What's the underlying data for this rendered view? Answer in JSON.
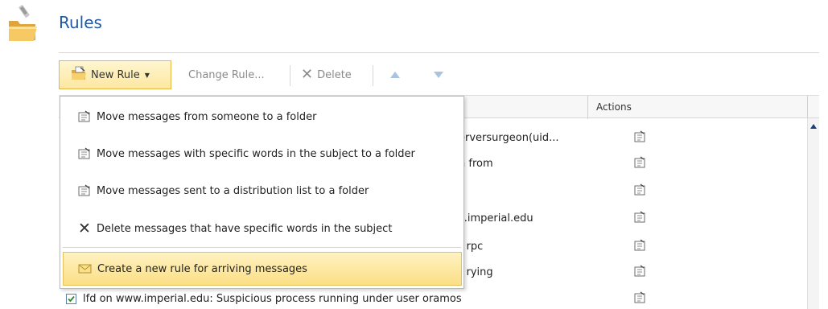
{
  "header": {
    "title": "Rules",
    "icon": "folder-rules-icon"
  },
  "toolbar": {
    "new_rule": "New Rule",
    "change_rule": "Change Rule...",
    "delete": "Delete",
    "move_up": "move-up-icon",
    "move_down": "move-down-icon"
  },
  "grid": {
    "columns": [
      "Actions"
    ],
    "rows": [
      {
        "name_visible": "erversurgeon(uid..."
      },
      {
        "name_visible": "n from"
      },
      {
        "name_visible": ""
      },
      {
        "name_visible": "s.imperial.edu"
      },
      {
        "name_visible": "r rpc"
      },
      {
        "name_visible": "r rying"
      }
    ],
    "last_row": {
      "checked": true,
      "name": "lfd on www.imperial.edu: Suspicious process running under user oramos"
    }
  },
  "menu": {
    "items": [
      {
        "label": "Move messages from someone to a folder",
        "icon": "move-to-folder-icon"
      },
      {
        "label": "Move messages with specific words in the subject to a folder",
        "icon": "move-to-folder-icon"
      },
      {
        "label": "Move messages sent to a distribution list to a folder",
        "icon": "move-to-folder-icon"
      },
      {
        "label": "Delete messages that have specific words in the subject",
        "icon": "delete-x-icon"
      }
    ],
    "highlighted": {
      "label": "Create a new rule for arriving messages",
      "icon": "envelope-icon"
    }
  },
  "colors": {
    "title": "#1f5aa8",
    "highlight": "#fbdf86",
    "highlight_border": "#e8c15a"
  }
}
